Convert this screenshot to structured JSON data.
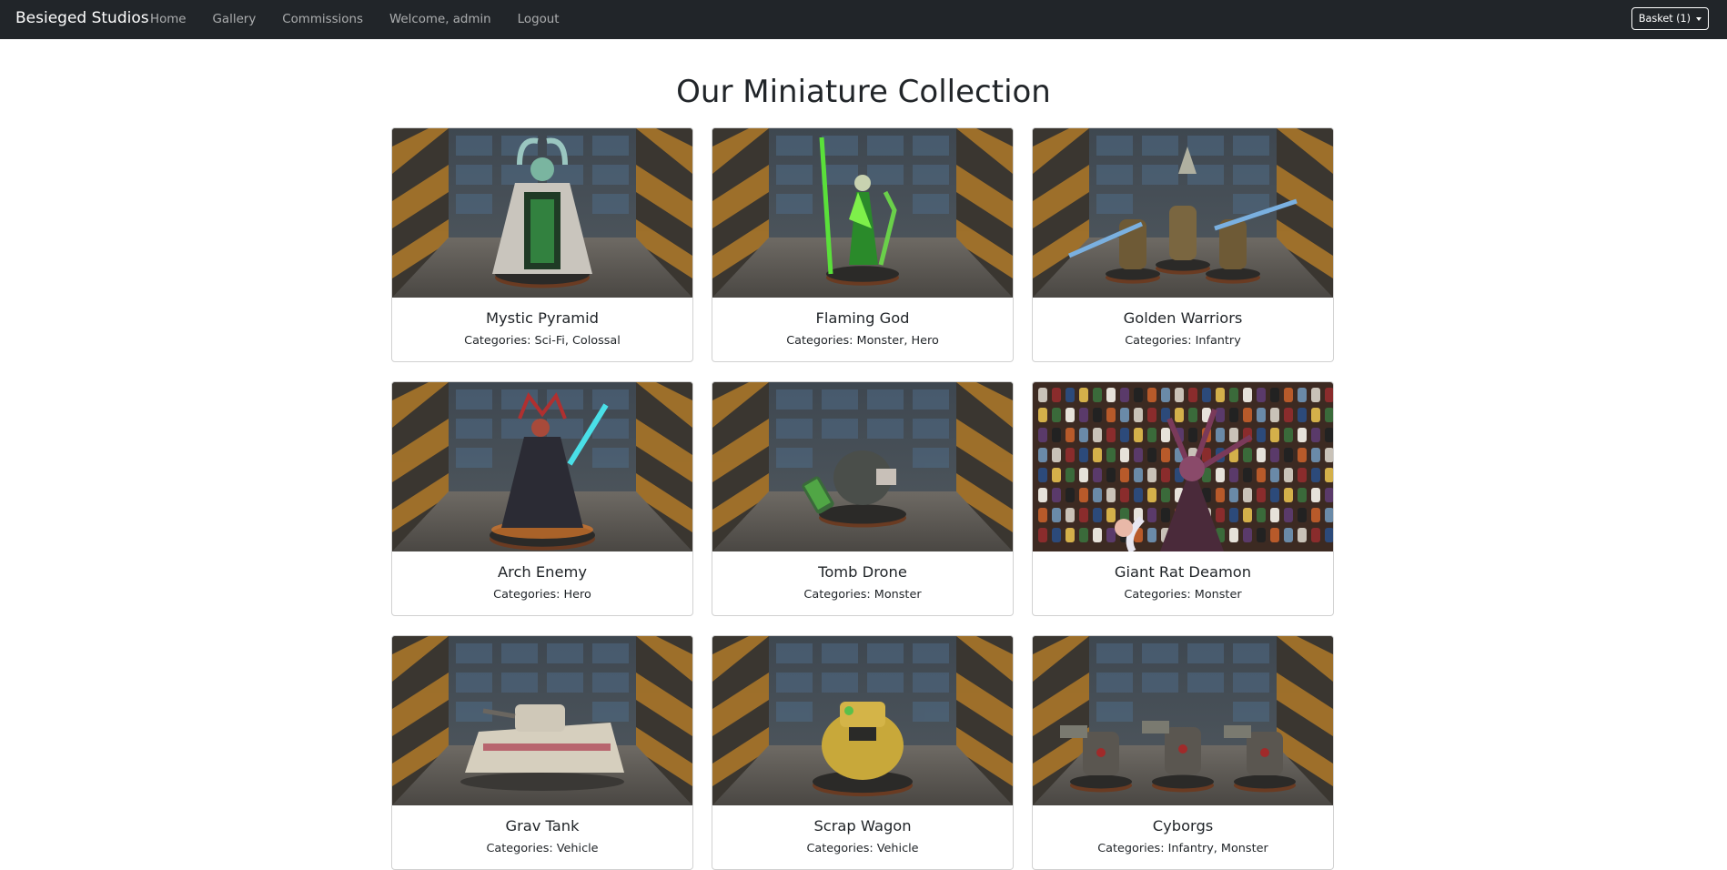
{
  "navbar": {
    "brand": "Besieged Studios",
    "links": [
      "Home",
      "Gallery",
      "Commissions"
    ],
    "welcome": "Welcome, admin",
    "logout": "Logout",
    "basket_label": "Basket (1)"
  },
  "page": {
    "title": "Our Miniature Collection"
  },
  "colors": {
    "navbar_bg": "#212529",
    "text": "#212529",
    "card_border": "#d6d6d6"
  },
  "cards": [
    {
      "title": "Mystic Pyramid",
      "categories": "Categories: Sci-Fi, Colossal",
      "scene": "hazard-room",
      "subject": "pyramid"
    },
    {
      "title": "Flaming God",
      "categories": "Categories: Monster, Hero",
      "scene": "hazard-room",
      "subject": "green-figure"
    },
    {
      "title": "Golden Warriors",
      "categories": "Categories: Infantry",
      "scene": "hazard-room",
      "subject": "warrior-group"
    },
    {
      "title": "Arch Enemy",
      "categories": "Categories: Hero",
      "scene": "hazard-room",
      "subject": "hero-figure"
    },
    {
      "title": "Tomb Drone",
      "categories": "Categories: Monster",
      "scene": "hazard-room",
      "subject": "drone"
    },
    {
      "title": "Giant Rat Deamon",
      "categories": "Categories: Monster",
      "scene": "paint-rack",
      "subject": "deamon"
    },
    {
      "title": "Grav Tank",
      "categories": "Categories: Vehicle",
      "scene": "hazard-room",
      "subject": "tank"
    },
    {
      "title": "Scrap Wagon",
      "categories": "Categories: Vehicle",
      "scene": "hazard-room",
      "subject": "wagon"
    },
    {
      "title": "Cyborgs",
      "categories": "Categories: Infantry, Monster",
      "scene": "hazard-room",
      "subject": "cyborg-group"
    }
  ]
}
